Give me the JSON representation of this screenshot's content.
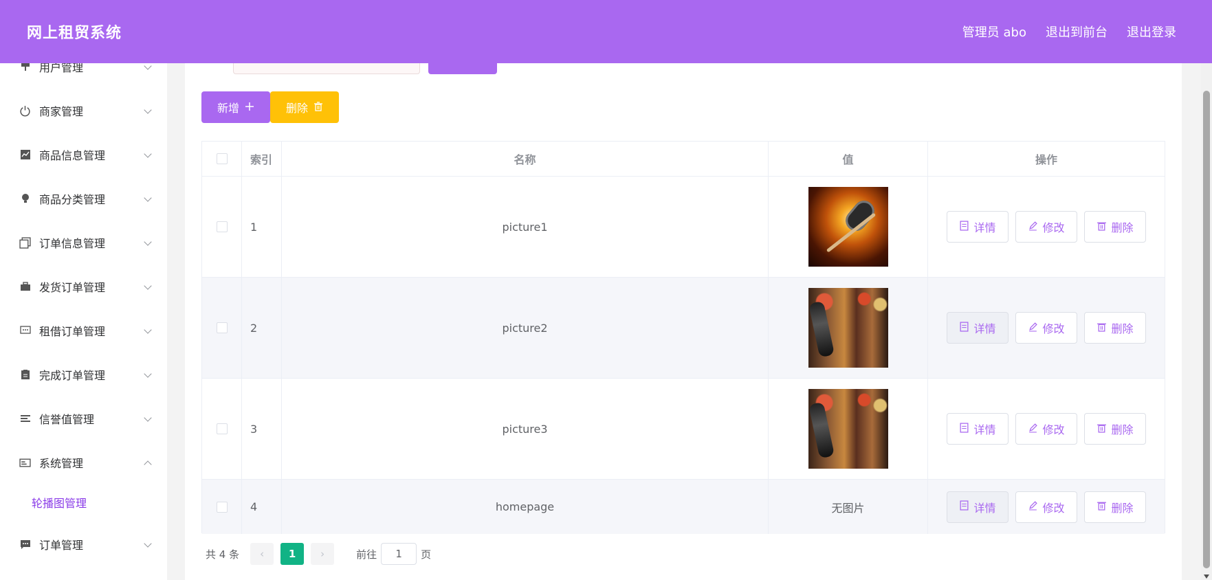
{
  "header": {
    "brand": "网上租贸系统",
    "links": [
      "管理员 abo",
      "退出到前台",
      "退出登录"
    ]
  },
  "sidebar": {
    "items": [
      {
        "label": "用户管理",
        "icon": "user-icon",
        "expanded": false
      },
      {
        "label": "商家管理",
        "icon": "power-icon",
        "expanded": false
      },
      {
        "label": "商品信息管理",
        "icon": "chart-icon",
        "expanded": false
      },
      {
        "label": "商品分类管理",
        "icon": "bulb-icon",
        "expanded": false
      },
      {
        "label": "订单信息管理",
        "icon": "copy-icon",
        "expanded": false
      },
      {
        "label": "发货订单管理",
        "icon": "briefcase-icon",
        "expanded": false
      },
      {
        "label": "租借订单管理",
        "icon": "chat-icon",
        "expanded": false
      },
      {
        "label": "完成订单管理",
        "icon": "clipboard-icon",
        "expanded": false
      },
      {
        "label": "信誉值管理",
        "icon": "list-icon",
        "expanded": false
      },
      {
        "label": "系统管理",
        "icon": "card-icon",
        "expanded": true
      },
      {
        "label": "订单管理",
        "icon": "message-icon",
        "expanded": false
      }
    ],
    "sub_item": "轮播图管理"
  },
  "toolbar": {
    "add_label": "新增",
    "delete_label": "删除"
  },
  "table": {
    "headers": {
      "index": "索引",
      "name": "名称",
      "value": "值",
      "ops": "操作"
    },
    "rows": [
      {
        "index": "1",
        "name": "picture1",
        "value": "",
        "image": "microphone"
      },
      {
        "index": "2",
        "name": "picture2",
        "value": "",
        "image": "stage"
      },
      {
        "index": "3",
        "name": "picture3",
        "value": "",
        "image": "stage"
      },
      {
        "index": "4",
        "name": "homepage",
        "value": "无图片",
        "image": ""
      }
    ],
    "ops": {
      "detail": "详情",
      "edit": "修改",
      "delete": "删除"
    }
  },
  "pager": {
    "total": "共 4 条",
    "current": "1",
    "goto_label": "前往",
    "goto_value": "1",
    "page_suffix": "页"
  },
  "colors": {
    "primary": "#a968f0",
    "warning": "#ffc107",
    "pager_active": "#11b385"
  }
}
